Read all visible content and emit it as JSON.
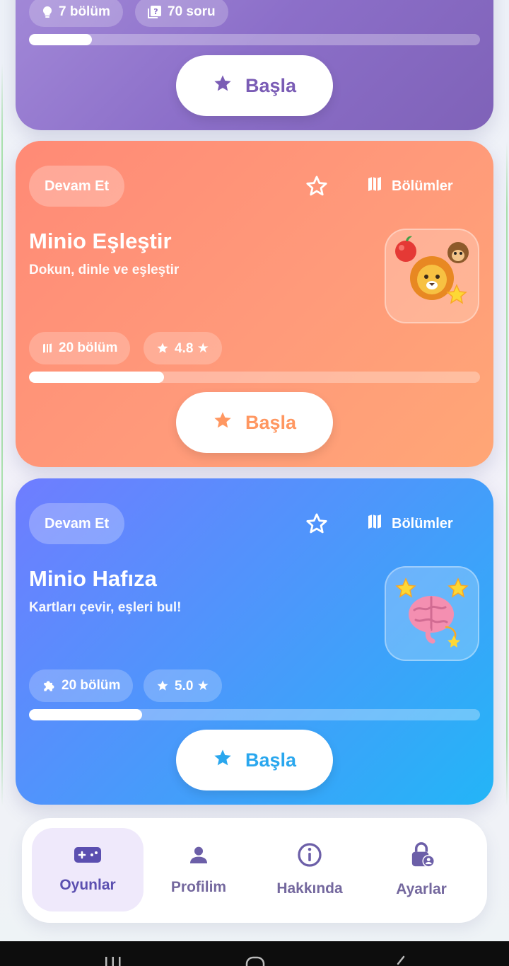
{
  "colors": {
    "purple_accent": "#7f62b8",
    "orange_accent": "#ff9761",
    "blue_accent": "#2aa7ee",
    "nav_active": "#5b4fb0"
  },
  "cards": [
    {
      "id": "purple",
      "stats": [
        {
          "icon": "lightbulb-icon",
          "label": "7 bölüm"
        },
        {
          "icon": "quiz-icon",
          "label": "70 soru"
        }
      ],
      "progress": 0.14,
      "start_label": "Başla"
    },
    {
      "id": "orange",
      "badge": "Devam Et",
      "chapters_label": "Bölümler",
      "title": "Minio Eşleştir",
      "subtitle": "Dokun, dinle ve eşleştir",
      "thumb_icon": "lion-icon",
      "stats": [
        {
          "icon": "map-icon",
          "label": "20 bölüm"
        },
        {
          "icon": "star-icon",
          "label": "4.8 ★"
        }
      ],
      "progress": 0.3,
      "start_label": "Başla"
    },
    {
      "id": "blue",
      "badge": "Devam Et",
      "chapters_label": "Bölümler",
      "title": "Minio Hafıza",
      "subtitle": "Kartları çevir, eşleri bul!",
      "thumb_icon": "brain-icon",
      "stats": [
        {
          "icon": "puzzle-icon",
          "label": "20 bölüm"
        },
        {
          "icon": "star-icon",
          "label": "5.0 ★"
        }
      ],
      "progress": 0.25,
      "start_label": "Başla"
    }
  ],
  "nav": {
    "items": [
      {
        "label": "Oyunlar",
        "icon": "gamepad-icon",
        "active": true
      },
      {
        "label": "Profilim",
        "icon": "person-icon",
        "active": false
      },
      {
        "label": "Hakkında",
        "icon": "info-icon",
        "active": false
      },
      {
        "label": "Ayarlar",
        "icon": "lock-person-icon",
        "active": false
      }
    ]
  }
}
